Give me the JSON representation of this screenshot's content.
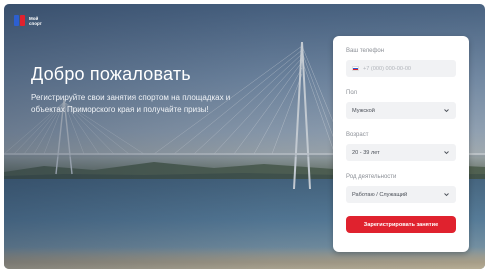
{
  "brand": {
    "logo_text": "Мой спорт"
  },
  "hero": {
    "title": "Добро пожаловать",
    "subtitle": "Регистрируйте свои занятия спортом на площадках и объектах Приморского края и получайте призы!"
  },
  "form": {
    "phone": {
      "label": "Ваш телефон",
      "placeholder": "+7 (000) 000-00-00"
    },
    "gender": {
      "label": "Пол",
      "value": "Мужской"
    },
    "age": {
      "label": "Возраст",
      "value": "20 - 39 лет"
    },
    "occupation": {
      "label": "Род деятельности",
      "value": "Работаю / Служащий"
    },
    "submit_label": "Зарегистрировать занятие"
  },
  "colors": {
    "accent": "#e0222e",
    "card": "#ffffff",
    "field": "#f1f2f4"
  },
  "icons": [
    "logo-icon",
    "russia-flag-icon",
    "chevron-down-icon"
  ]
}
